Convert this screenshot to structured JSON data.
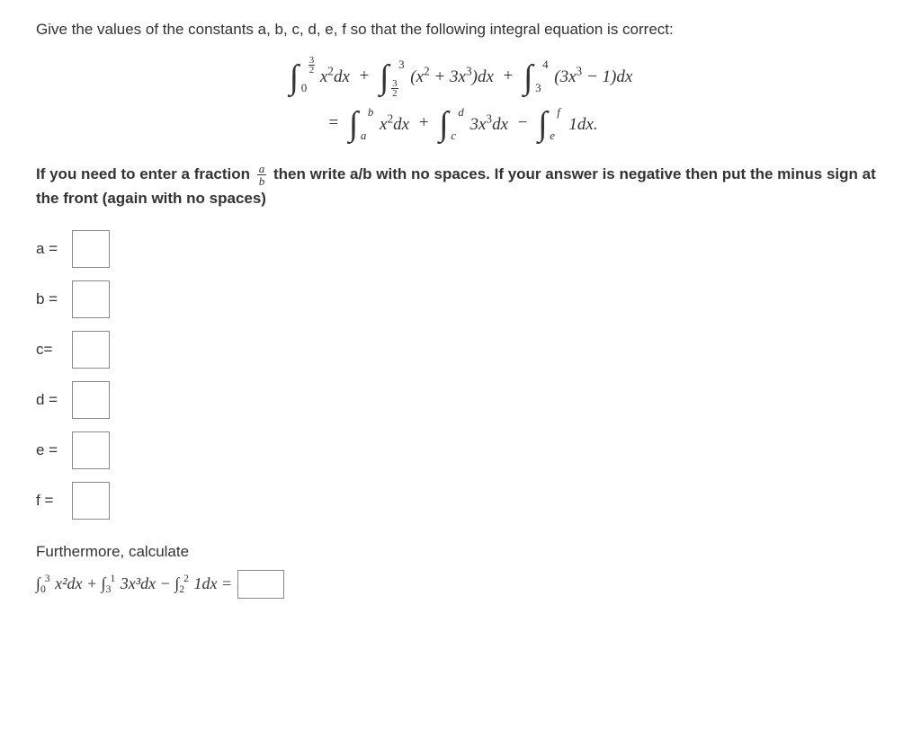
{
  "prompt": "Give the values of the constants a, b, c, d, e, f  so that the following integral equation is correct:",
  "equation": {
    "line1": {
      "term1": {
        "lower": "0",
        "upper_frac": {
          "num": "3",
          "den": "2"
        },
        "integrand": "x²dx"
      },
      "op1": "+",
      "term2": {
        "lower_frac": {
          "num": "3",
          "den": "2"
        },
        "upper": "3",
        "integrand": "(x² + 3x³)dx"
      },
      "op2": "+",
      "term3": {
        "lower": "3",
        "upper": "4",
        "integrand": "(3x³ − 1)dx"
      }
    },
    "line2": {
      "eq": "=",
      "term1": {
        "lower": "a",
        "upper": "b",
        "integrand": "x²dx"
      },
      "op1": "+",
      "term2": {
        "lower": "c",
        "upper": "d",
        "integrand": "3x³dx"
      },
      "op2": "−",
      "term3": {
        "lower": "e",
        "upper": "f",
        "integrand": "1dx."
      }
    }
  },
  "instructions_part1": "If you need to enter a fraction ",
  "instructions_part2": " then write a/b with no spaces. If your answer is negative then put the minus sign at the front (again with no spaces)",
  "frac_example": {
    "num": "a",
    "den": "b"
  },
  "answers": {
    "a": "a =",
    "b": "b =",
    "c": "c=",
    "d": "d =",
    "e": "e =",
    "f": "f ="
  },
  "furthermore": "Furthermore, calculate",
  "calc_expr_prefix": "∫",
  "calc": {
    "t1": {
      "low": "0",
      "up": "3",
      "body": " x²dx"
    },
    "p1": " + ",
    "t2": {
      "low": "3",
      "up": "1",
      "body": " 3x³dx"
    },
    "p2": " − ",
    "t3": {
      "low": "2",
      "up": "2",
      "body": " 1dx"
    },
    "eq": " = "
  }
}
